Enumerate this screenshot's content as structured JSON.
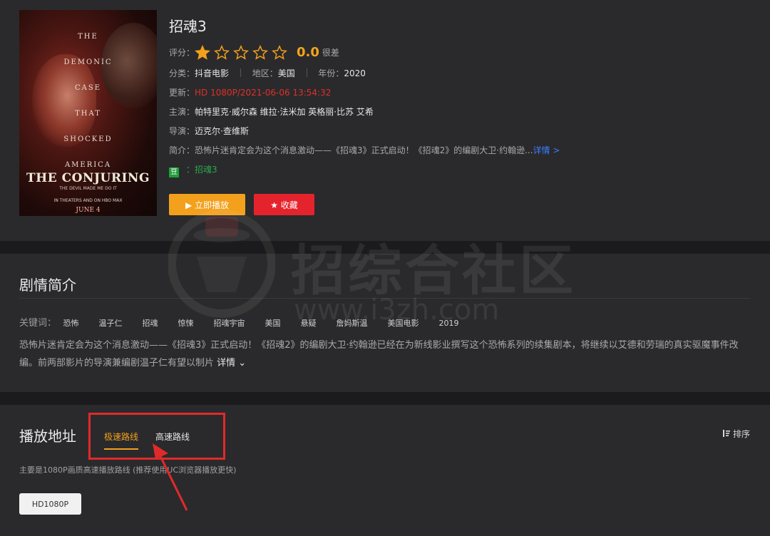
{
  "poster": {
    "tagline": [
      "THE",
      "DEMONIC",
      "CASE",
      "THAT",
      "SHOCKED",
      "AMERICA"
    ],
    "logo": "THE CONJURING",
    "logo_sub": "THE DEVIL MADE ME DO IT",
    "in_theaters": "IN THEATERS AND ON HBO MAX",
    "date": "JUNE 4"
  },
  "movie": {
    "title": "招魂3",
    "rating_label": "评分：",
    "rating_value": 1,
    "rating_max": 5,
    "score": "0.0",
    "score_text": "很差",
    "category_label": "分类：",
    "category": "抖音电影",
    "region_label": "地区：",
    "region": "美国",
    "year_label": "年份：",
    "year": "2020",
    "update_label": "更新：",
    "update": "HD 1080P/2021-06-06 13:54:32",
    "cast_label": "主演：",
    "cast": "帕特里克·威尔森 维拉·法米加 英格丽·比苏 艾希",
    "director_label": "导演：",
    "director": "迈克尔·查维斯",
    "summary_label": "简介：",
    "summary": "恐怖片迷肯定会为这个消息激动——《招魂3》正式启动！《招魂2》的编剧大卫·约翰逊...",
    "summary_more": "详情 >",
    "douban_badge": "豆",
    "douban_link": "：招魂3"
  },
  "buttons": {
    "play": "▶ 立即播放",
    "favorite": "★ 收藏"
  },
  "plot_section": {
    "title": "剧情简介",
    "keywords_label": "关键词：",
    "keywords": [
      "恐怖",
      "温子仁",
      "招魂",
      "惊悚",
      "招魂宇宙",
      "美国",
      "悬疑",
      "詹妈斯温",
      "美国电影",
      "2019"
    ],
    "description": "恐怖片迷肯定会为这个消息激动——《招魂3》正式启动！《招魂2》的编剧大卫·约翰逊已经在为新线影业撰写这个恐怖系列的续集剧本，将继续以艾德和劳瑞的真实驱魔事件改编。前两部影片的导演兼编剧温子仁有望以制片",
    "more": "详情 ⌄"
  },
  "play_section": {
    "title": "播放地址",
    "tabs": [
      "极速路线",
      "高速路线"
    ],
    "sort": "排序",
    "note": "主要是1080P画质高速播放路线 (推荐使用UC浏览器播放更快)",
    "episode": "HD1080P"
  },
  "watermark": {
    "text": "招综合社区",
    "url": "www.i3zh.com"
  },
  "colors": {
    "accent": "#f3a01c",
    "danger": "#e4232d",
    "annotation": "#e02a2a"
  }
}
